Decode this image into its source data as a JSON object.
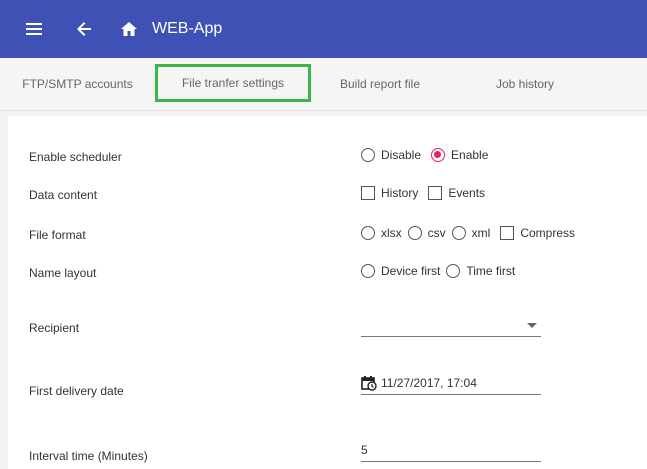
{
  "appbar": {
    "title": "WEB-App",
    "menu_icon": "menu-icon",
    "back_icon": "arrow-left-icon",
    "home_icon": "home-icon"
  },
  "tabs": [
    {
      "label": "FTP/SMTP accounts"
    },
    {
      "label": "File tranfer settings",
      "active": true
    },
    {
      "label": "Build report file"
    },
    {
      "label": "Job history"
    }
  ],
  "form": {
    "enable_scheduler": {
      "label": "Enable scheduler",
      "options": [
        "Disable",
        "Enable"
      ],
      "selected": "Enable"
    },
    "data_content": {
      "label": "Data content",
      "options": [
        "History",
        "Events"
      ]
    },
    "file_format": {
      "label": "File format",
      "options": [
        "xlsx",
        "csv",
        "xml"
      ],
      "compress": "Compress"
    },
    "name_layout": {
      "label": "Name layout",
      "options": [
        "Device first",
        "Time first"
      ]
    },
    "recipient": {
      "label": "Recipient",
      "value": ""
    },
    "first_delivery": {
      "label": "First delivery date",
      "value": "11/27/2017, 17:04",
      "icon": "calendar-clock-icon"
    },
    "interval": {
      "label": "Interval time (Minutes)",
      "value": "5"
    }
  },
  "colors": {
    "appbar": "#3f51b5",
    "accent": "#e91e63",
    "highlight": "#3bb54a"
  }
}
